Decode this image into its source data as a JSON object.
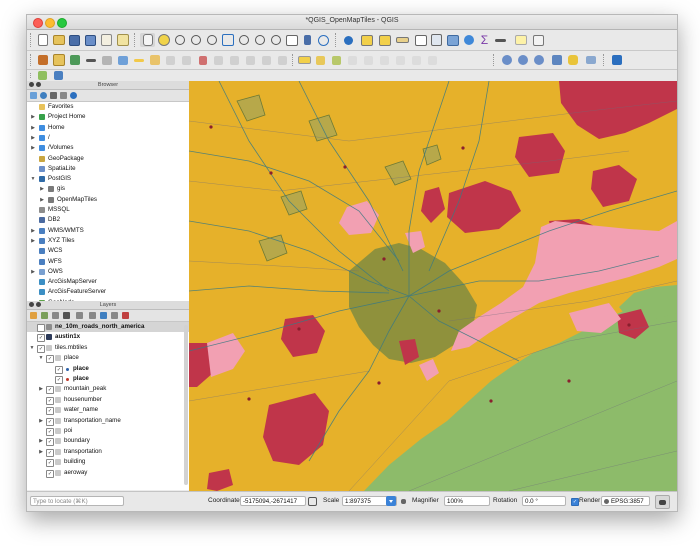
{
  "window": {
    "title": "*QGIS_OpenMapTiles - QGIS"
  },
  "browser": {
    "header": "Browser",
    "items": [
      {
        "label": "Favorites",
        "icon": "star-icon",
        "expander": "none",
        "color": "#e8c25a"
      },
      {
        "label": "Project Home",
        "icon": "project-home-icon",
        "expander": "right",
        "color": "#37a14a"
      },
      {
        "label": "Home",
        "icon": "home-folder-icon",
        "expander": "right",
        "color": "#3e8de0"
      },
      {
        "label": "/",
        "icon": "folder-icon",
        "expander": "right",
        "color": "#3e8de0"
      },
      {
        "label": "/Volumes",
        "icon": "folder-icon",
        "expander": "right",
        "color": "#3e8de0"
      },
      {
        "label": "GeoPackage",
        "icon": "geopackage-icon",
        "expander": "none",
        "color": "#c9a640"
      },
      {
        "label": "SpatiaLite",
        "icon": "spatialite-icon",
        "expander": "none",
        "color": "#6a8ec9"
      },
      {
        "label": "PostGIS",
        "icon": "postgis-icon",
        "expander": "down",
        "color": "#2f6aa6"
      },
      {
        "label": "gis",
        "icon": "db-schema-icon",
        "expander": "right",
        "color": "#7a7a7a",
        "indent": 1
      },
      {
        "label": "OpenMapTiles",
        "icon": "db-schema-icon",
        "expander": "right",
        "color": "#7a7a7a",
        "indent": 1
      },
      {
        "label": "MSSQL",
        "icon": "mssql-icon",
        "expander": "none",
        "color": "#8c8c8c"
      },
      {
        "label": "DB2",
        "icon": "db2-icon",
        "expander": "none",
        "color": "#4a6aa0"
      },
      {
        "label": "WMS/WMTS",
        "icon": "wms-icon",
        "expander": "right",
        "color": "#4a7fc0"
      },
      {
        "label": "XYZ Tiles",
        "icon": "xyz-tiles-icon",
        "expander": "right",
        "color": "#4a7fc0"
      },
      {
        "label": "WCS",
        "icon": "wcs-icon",
        "expander": "none",
        "color": "#4a7fc0"
      },
      {
        "label": "WFS",
        "icon": "wfs-icon",
        "expander": "none",
        "color": "#4a7fc0"
      },
      {
        "label": "OWS",
        "icon": "ows-icon",
        "expander": "right",
        "color": "#7aa0d0"
      },
      {
        "label": "ArcGisMapServer",
        "icon": "arcgis-icon",
        "expander": "none",
        "color": "#3c8fc4"
      },
      {
        "label": "ArcGisFeatureServer",
        "icon": "arcgis-icon",
        "expander": "none",
        "color": "#3c8fc4"
      },
      {
        "label": "GeoNode",
        "icon": "geonode-icon",
        "expander": "none",
        "color": "#5ea34a"
      }
    ]
  },
  "layers": {
    "header": "Layers",
    "items": [
      {
        "label": "ne_10m_roads_north_america",
        "icon": "line-layer-icon",
        "expander": "none",
        "check": false,
        "bold": true,
        "selected": true,
        "indent": 0,
        "color": "#8c8c8c"
      },
      {
        "label": "austin1x",
        "icon": "raster-layer-icon",
        "expander": "none",
        "check": true,
        "bold": true,
        "indent": 0,
        "color": "#2d3b5a"
      },
      {
        "label": "tiles.mbtiles",
        "icon": "vector-tiles-icon",
        "expander": "down",
        "check": true,
        "bold": false,
        "indent": 0,
        "color": "#c9c9c9"
      },
      {
        "label": "place",
        "icon": "group-icon",
        "expander": "down",
        "check": true,
        "bold": false,
        "indent": 1,
        "color": "#c9c9c9"
      },
      {
        "label": "place",
        "icon": "point-symbol-icon",
        "expander": "none",
        "check": true,
        "bold": true,
        "indent": 2,
        "color": "#2b5fa8"
      },
      {
        "label": "place",
        "icon": "point-symbol-icon",
        "expander": "none",
        "check": true,
        "bold": true,
        "indent": 2,
        "color": "#c0392b"
      },
      {
        "label": "mountain_peak",
        "icon": "group-icon",
        "expander": "right",
        "check": true,
        "bold": false,
        "indent": 1,
        "color": "#c9c9c9"
      },
      {
        "label": "housenumber",
        "icon": "group-icon",
        "expander": "none",
        "check": true,
        "bold": false,
        "indent": 1,
        "color": "#c9c9c9"
      },
      {
        "label": "water_name",
        "icon": "group-icon",
        "expander": "none",
        "check": true,
        "bold": false,
        "indent": 1,
        "color": "#c9c9c9"
      },
      {
        "label": "transportation_name",
        "icon": "group-icon",
        "expander": "right",
        "check": true,
        "bold": false,
        "indent": 1,
        "color": "#c9c9c9"
      },
      {
        "label": "poi",
        "icon": "group-icon",
        "expander": "none",
        "check": true,
        "bold": false,
        "indent": 1,
        "color": "#c9c9c9"
      },
      {
        "label": "boundary",
        "icon": "group-icon",
        "expander": "right",
        "check": true,
        "bold": false,
        "indent": 1,
        "color": "#c9c9c9"
      },
      {
        "label": "transportation",
        "icon": "group-icon",
        "expander": "right",
        "check": true,
        "bold": false,
        "indent": 1,
        "color": "#c9c9c9"
      },
      {
        "label": "building",
        "icon": "group-icon",
        "expander": "none",
        "check": true,
        "bold": false,
        "indent": 1,
        "color": "#c9c9c9"
      },
      {
        "label": "aeroway",
        "icon": "group-icon",
        "expander": "none",
        "check": true,
        "bold": false,
        "indent": 1,
        "color": "#c9c9c9"
      }
    ]
  },
  "status": {
    "locate_placeholder": "Type to locate (⌘K)",
    "coordinate_label": "Coordinate",
    "coordinate_value": "-5175094,-2671417",
    "scale_label": "Scale",
    "scale_value": "1:897375",
    "magnifier_label": "Magnifier",
    "magnifier_value": "100%",
    "rotation_label": "Rotation",
    "rotation_value": "0.0 °",
    "render_label": "Render",
    "render_checked": true,
    "crs_label": "EPSG:3857"
  },
  "map": {
    "colors": {
      "land": "#e6b12a",
      "urban": "#7f8c3f",
      "water": "#8dbb6a",
      "residential": "#f2a0b2",
      "industrial": "#c0354a",
      "roads": "#3b7a82"
    }
  },
  "toolbar_icons": [
    "new-project-icon",
    "open-project-icon",
    "save-project-icon",
    "save-as-icon",
    "print-layout-icon",
    "layout-manager-icon",
    "pan-icon",
    "pan-to-selection-icon",
    "zoom-in-icon",
    "zoom-out-icon",
    "zoom-full-icon",
    "zoom-layer-icon",
    "zoom-selection-icon",
    "zoom-last-icon",
    "zoom-next-icon",
    "new-map-view-icon",
    "bookmarks-icon",
    "refresh-icon",
    "identify-icon",
    "select-features-icon",
    "deselect-icon",
    "measure-icon",
    "open-attribute-table-icon",
    "field-calculator-icon",
    "statistics-icon",
    "processing-toolbox-icon",
    "sum-icon",
    "annotation-icon",
    "map-tips-icon"
  ]
}
